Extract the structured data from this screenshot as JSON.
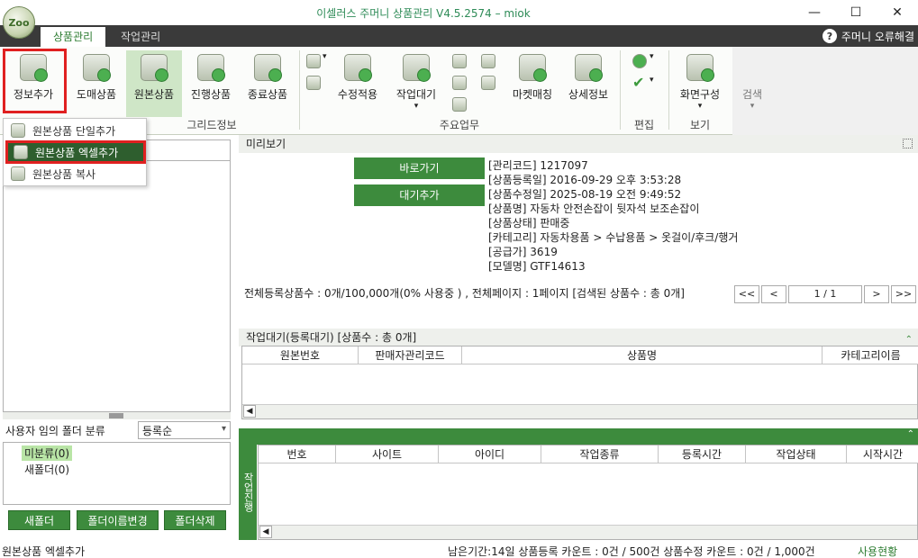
{
  "window": {
    "title": "이셀러스 주머니 상품관리 V4.5.2574 – miok",
    "logo_text": "Zoo",
    "minimize": "—",
    "maximize": "☐",
    "close": "✕"
  },
  "tabs": [
    {
      "label": "상품관리",
      "active": true
    },
    {
      "label": "작업관리",
      "active": false
    }
  ],
  "help": {
    "icon": "?",
    "label": "주머니 오류해결"
  },
  "ribbon": {
    "buttons": [
      {
        "label": "정보추가"
      },
      {
        "label": "도매상품"
      },
      {
        "label": "원본상품"
      },
      {
        "label": "진행상품"
      },
      {
        "label": "종료상품"
      },
      {
        "label": "수정적용"
      },
      {
        "label": "작업대기"
      },
      {
        "label": "마켓매칭"
      },
      {
        "label": "상세정보"
      },
      {
        "label": "화면구성"
      },
      {
        "label": "검색"
      }
    ],
    "groups": [
      "그리드정보",
      "주요업무",
      "편집",
      "보기"
    ],
    "dropdown_glyph": "▾"
  },
  "menu": {
    "items": [
      {
        "label": "원본상품 단일추가"
      },
      {
        "label": "원본상품 엑셀추가"
      },
      {
        "label": "원본상품 복사"
      }
    ]
  },
  "left": {
    "folder_label": "사용자 임의 폴더 분류",
    "sort_value": "등록순",
    "folders": [
      {
        "label": "미분류(0)"
      },
      {
        "label": "새폴더(0)"
      }
    ],
    "buttons": [
      "새폴더",
      "폴더이름변경",
      "폴더삭제"
    ]
  },
  "preview": {
    "title": "미리보기",
    "buttons": [
      "바로가기",
      "대기추가"
    ],
    "lines": [
      "[관리코드] 1217097",
      "[상품등록일] 2016-09-29 오후 3:53:28",
      "[상품수정일] 2025-08-19 오전 9:49:52",
      "[상품명] 자동차 안전손잡이 뒷자석 보조손잡이",
      "[상품상태] 판매중",
      "[카테고리] 자동차용품 > 수납용품 > 옷걸이/후크/행거",
      "[공급가] 3619",
      "[모델명] GTF14613"
    ],
    "summary": "전체등록상품수 : 0개/100,000개(0% 사용중 ) , 전체페이지 : 1페이지  [검색된 상품수 : 총 0개]",
    "pager": {
      "first": "<<",
      "prev": "<",
      "page": "1 / 1",
      "next": ">",
      "last": ">>"
    }
  },
  "queue": {
    "title": "작업대기(등록대기)  [상품수 : 총 0개]",
    "columns": [
      "원본번호",
      "판매자관리코드",
      "상품명",
      "카테고리이름"
    ]
  },
  "progress": {
    "side_label": "작업진행",
    "columns": [
      "번호",
      "사이트",
      "아이디",
      "작업종류",
      "등록시간",
      "작업상태",
      "시작시간"
    ]
  },
  "status": {
    "left": "원본상품 엑셀추가",
    "right": "남은기간:14일  상품등록 카운트 : 0건 / 500건   상품수정 카운트 : 0건 / 1,000건",
    "usage": "사용현황"
  }
}
